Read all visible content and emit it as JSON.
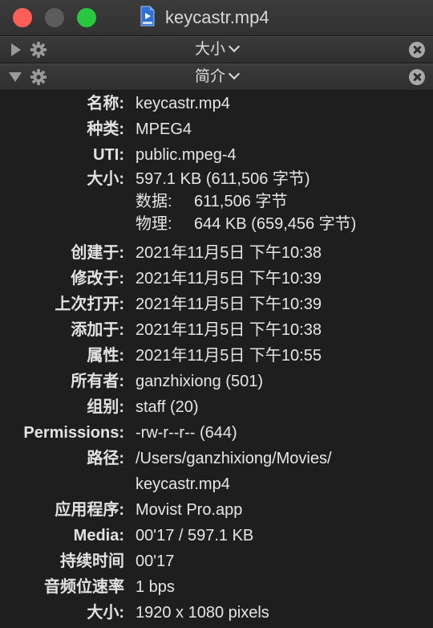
{
  "window": {
    "title": "keycastr.mp4",
    "file_icon": "mp4-file-icon"
  },
  "sections": [
    {
      "title": "大小",
      "expanded": false
    },
    {
      "title": "简介",
      "expanded": true
    }
  ],
  "info": {
    "name": {
      "label": "名称:",
      "value": "keycastr.mp4"
    },
    "kind": {
      "label": "种类:",
      "value": "MPEG4"
    },
    "uti": {
      "label": "UTI:",
      "value": "public.mpeg-4"
    },
    "size": {
      "label": "大小:",
      "value": "597.1 KB (611,506 字节)"
    },
    "data_size": {
      "label": "数据:",
      "value": "611,506 字节"
    },
    "physical_size": {
      "label": "物理:",
      "value": "644 KB (659,456 字节)"
    },
    "created": {
      "label": "创建于:",
      "value": "2021年11月5日 下午10:38"
    },
    "modified": {
      "label": "修改于:",
      "value": "2021年11月5日 下午10:39"
    },
    "last_opened": {
      "label": "上次打开:",
      "value": "2021年11月5日 下午10:39"
    },
    "added": {
      "label": "添加于:",
      "value": "2021年11月5日 下午10:38"
    },
    "attributes": {
      "label": "属性:",
      "value": "2021年11月5日 下午10:55"
    },
    "owner": {
      "label": "所有者:",
      "value": "ganzhixiong (501)"
    },
    "group": {
      "label": "组别:",
      "value": "staff (20)"
    },
    "permissions": {
      "label": "Permissions:",
      "value": "-rw-r--r-- (644)"
    },
    "path": {
      "label": "路径:",
      "value_line1": "/Users/ganzhixiong/Movies/",
      "value_line2": "keycastr.mp4"
    },
    "application": {
      "label": "应用程序:",
      "value": "Movist Pro.app"
    },
    "media": {
      "label": "Media:",
      "value": "00'17 / 597.1 KB"
    },
    "duration": {
      "label": "持续时间",
      "value": "00'17"
    },
    "audio_bitrate": {
      "label": "音频位速率",
      "value": "1 bps"
    },
    "dimensions": {
      "label": "大小:",
      "value": "1920 x 1080 pixels"
    }
  },
  "colors": {
    "background": "#1e1e1e",
    "close": "#fe5f57",
    "minimize": "#5c5c5c",
    "zoom": "#28c840"
  }
}
